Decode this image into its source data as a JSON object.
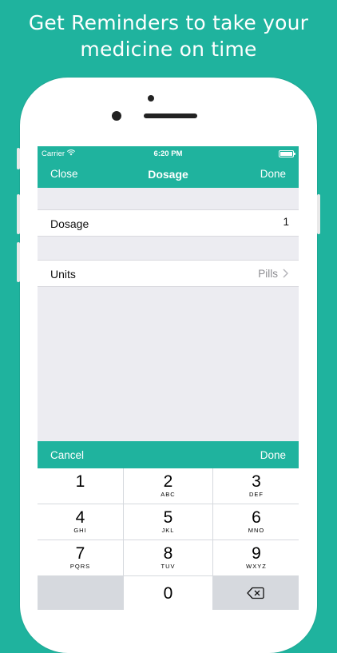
{
  "promo": {
    "line1": "Get Reminders to take your",
    "line2": "medicine on time"
  },
  "status_bar": {
    "carrier": "Carrier",
    "time": "6:20 PM"
  },
  "nav_bar": {
    "left": "Close",
    "title": "Dosage",
    "right": "Done"
  },
  "form": {
    "dosage_label": "Dosage",
    "dosage_value": "1",
    "units_label": "Units",
    "units_value": "Pills"
  },
  "keyboard_toolbar": {
    "cancel": "Cancel",
    "done": "Done"
  },
  "keypad": {
    "keys": [
      {
        "num": "1",
        "letters": ""
      },
      {
        "num": "2",
        "letters": "ABC"
      },
      {
        "num": "3",
        "letters": "DEF"
      },
      {
        "num": "4",
        "letters": "GHI"
      },
      {
        "num": "5",
        "letters": "JKL"
      },
      {
        "num": "6",
        "letters": "MNO"
      },
      {
        "num": "7",
        "letters": "PQRS"
      },
      {
        "num": "8",
        "letters": "TUV"
      },
      {
        "num": "9",
        "letters": "WXYZ"
      },
      {
        "num": "0",
        "letters": ""
      }
    ]
  },
  "colors": {
    "accent": "#1fb39e",
    "grouped_background": "#ececf1"
  },
  "icons": {
    "wifi": "wifi-icon",
    "battery": "battery-icon",
    "disclosure": "chevron-right-icon",
    "backspace": "backspace-icon"
  }
}
